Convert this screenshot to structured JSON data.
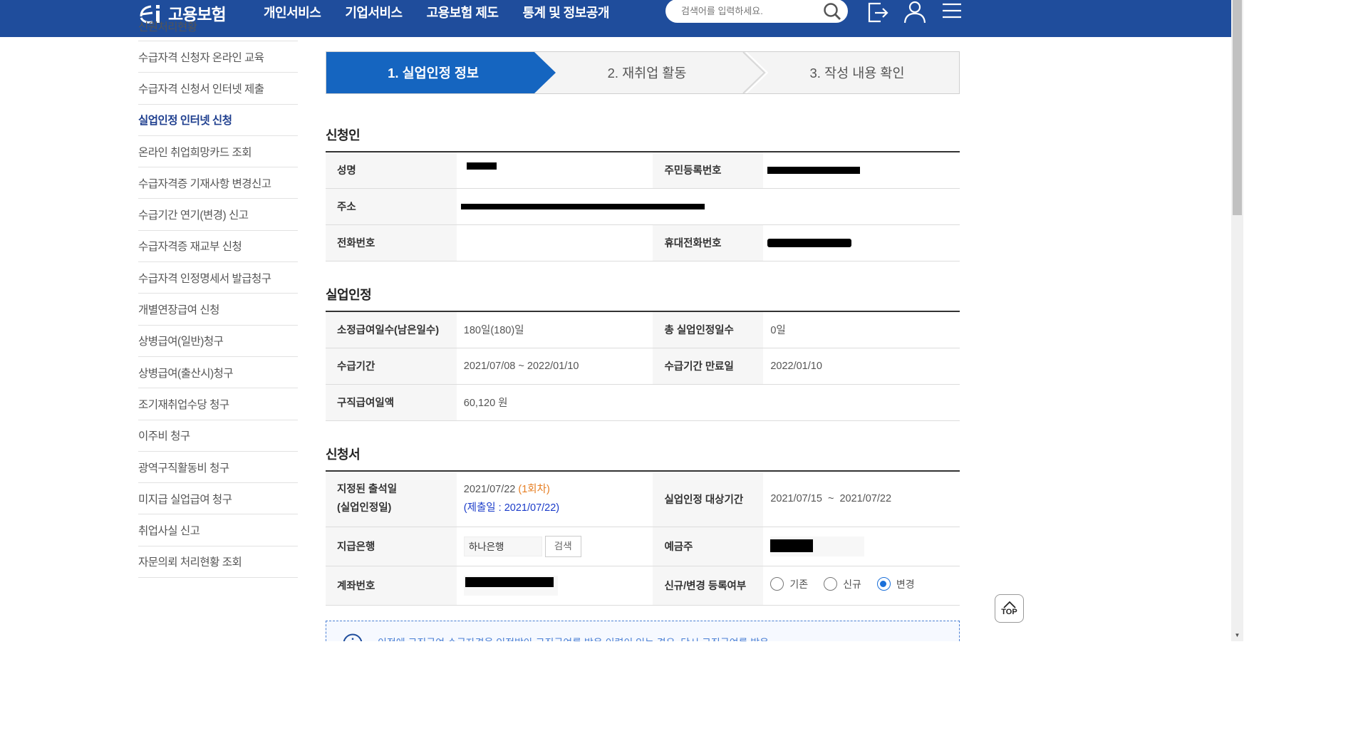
{
  "header": {
    "logo_text": "고용보험",
    "nav": [
      "개인서비스",
      "기업서비스",
      "고용보험 제도",
      "통계 및 정보공개"
    ],
    "search_placeholder": "검색어를 입력하세요."
  },
  "sidebar": {
    "items": [
      {
        "label": "신원처리현황",
        "state": "cut"
      },
      {
        "label": "수급자격 신청자 온라인 교육"
      },
      {
        "label": "수급자격 신청서 인터넷 제출"
      },
      {
        "label": "실업인정 인터넷 신청",
        "state": "active"
      },
      {
        "label": "온라인 취업희망카드 조회"
      },
      {
        "label": "수급자격증 기재사항 변경신고"
      },
      {
        "label": "수급기간 연기(변경) 신고"
      },
      {
        "label": "수급자격증 재교부 신청"
      },
      {
        "label": "수급자격 인정명세서 발급청구"
      },
      {
        "label": "개별연장급여 신청"
      },
      {
        "label": "상병급여(일반)청구"
      },
      {
        "label": "상병급여(출산시)청구"
      },
      {
        "label": "조기재취업수당 청구"
      },
      {
        "label": "이주비 청구"
      },
      {
        "label": "광역구직활동비 청구"
      },
      {
        "label": "미지급 실업급여 청구"
      },
      {
        "label": "취업사실 신고"
      },
      {
        "label": "자문의뢰 처리현황 조회"
      }
    ]
  },
  "steps": [
    {
      "label": "1. 실업인정 정보",
      "active": true
    },
    {
      "label": "2. 재취업 활동",
      "active": false
    },
    {
      "label": "3. 작성 내용 확인",
      "active": false
    }
  ],
  "applicant": {
    "title": "신청인",
    "name_label": "성명",
    "rrn_label": "주민등록번호",
    "address_label": "주소",
    "phone_label": "전화번호",
    "mobile_label": "휴대전화번호"
  },
  "recognition": {
    "title": "실업인정",
    "days_label": "소정급여일수(남은일수)",
    "days_value": "180일(180)일",
    "total_label": "총 실업인정일수",
    "total_value": "0일",
    "period_label": "수급기간",
    "period_value": "2021/07/08 ~ 2022/01/10",
    "expire_label": "수급기간 만료일",
    "expire_value": "2022/01/10",
    "amount_label": "구직급여일액",
    "amount_value": "60,120 원"
  },
  "application": {
    "title": "신청서",
    "date_label_1": "지정된 출석일",
    "date_label_2": "(실업인정일)",
    "date_value": "2021/07/22",
    "date_count": "(1회차)",
    "submit_value": "(제출일 : 2021/07/22)",
    "target_label": "실업인정 대상기간",
    "target_value": "2021/07/15  ~  2021/07/22",
    "bank_label": "지급은행",
    "bank_value": "하나은행",
    "bank_search_btn": "검색",
    "holder_label": "예금주",
    "account_label": "계좌번호",
    "reg_label": "신규/변경 등록여부",
    "reg_options": [
      "기존",
      "신규",
      "변경"
    ],
    "reg_selected": "변경"
  },
  "notice": {
    "text": "이전에 구직급여 수급자격을 인정받아 구직급여를 받은 이력이 있는 경우, 당시 구직급여를 받은"
  },
  "top_button": "TOP",
  "colors": {
    "header": "#1f4d9c",
    "step_active": "#1565c0",
    "orange": "#e67e22",
    "blue_text": "#1a3bc9"
  }
}
